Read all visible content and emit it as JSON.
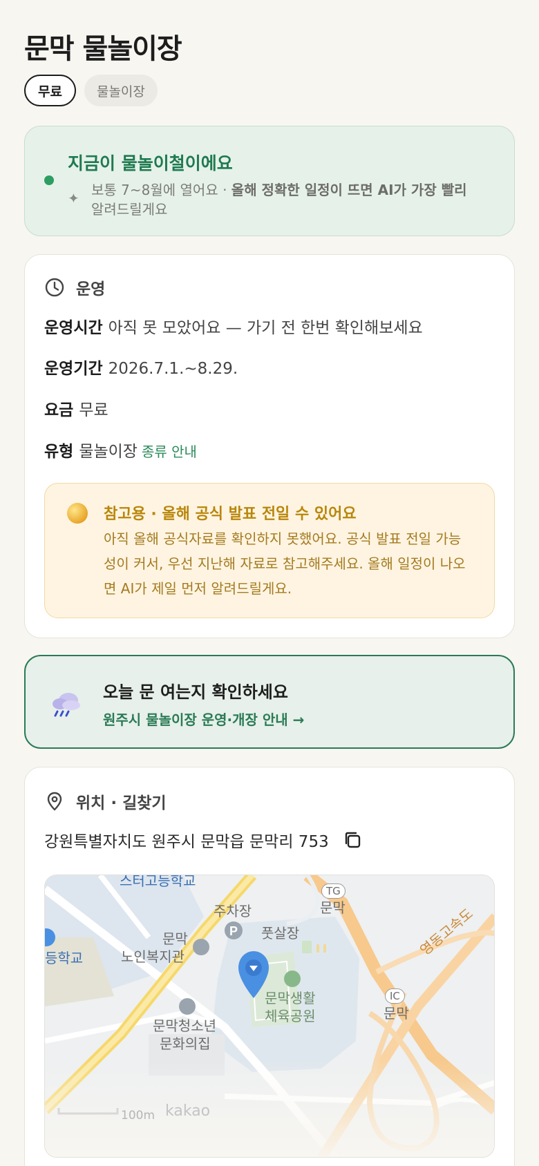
{
  "page": {
    "title": "문막 물놀이장"
  },
  "chips": [
    {
      "label": "무료"
    },
    {
      "label": "물놀이장"
    }
  ],
  "season": {
    "title": "지금이 물놀이철이에요",
    "sub_plain": "보통 7~8월에 열어요 · ",
    "sub_bold": "올해 정확한 일정이 뜨면 AI가 가장 빨리",
    "sub_tail": "알려드릴게요",
    "status_color": "#2e9d62"
  },
  "operation": {
    "section_title": "운영",
    "rows": [
      {
        "key": "운영시간",
        "value": "아직 못 모았어요 — 가기 전 한번 확인해보세요"
      },
      {
        "key": "운영기간",
        "value": "2026.7.1.~8.29."
      },
      {
        "key": "요금",
        "value": "무료"
      },
      {
        "key": "유형",
        "value": "물놀이장",
        "link": "종류 안내"
      }
    ],
    "notice": {
      "title": "참고용 · 올해 공식 발표 전일 수 있어요",
      "body": "아직 올해 공식자료를 확인하지 못했어요. 공식 발표 전일 가능성이 커서, 우선 지난해 자료로 참고해주세요. 올해 일정이 나오면 AI가 제일 먼저 알려드릴게요."
    }
  },
  "check": {
    "title": "오늘 문 여는지 확인하세요",
    "link": "원주시 물놀이장 운영·개장 안내 →"
  },
  "location": {
    "section_title": "위치 · 길찾기",
    "address": "강원특별자치도 원주시 문막읍 문막리 753",
    "map": {
      "labels": {
        "school_top": "스터고등학교",
        "tg_badge": "TG",
        "tg_name": "문막",
        "parking": "주차장",
        "futsal": "풋살장",
        "elder_1": "문막",
        "elder_2": "노인복지관",
        "school_left": "등학교",
        "park_1": "문막생활",
        "park_2": "체육공원",
        "youth_1": "문막청소년",
        "youth_2": "문화의집",
        "ic_badge": "IC",
        "ic_name": "문막",
        "highway": "영동고속도",
        "scale": "100m",
        "brand": "kakao"
      }
    }
  }
}
